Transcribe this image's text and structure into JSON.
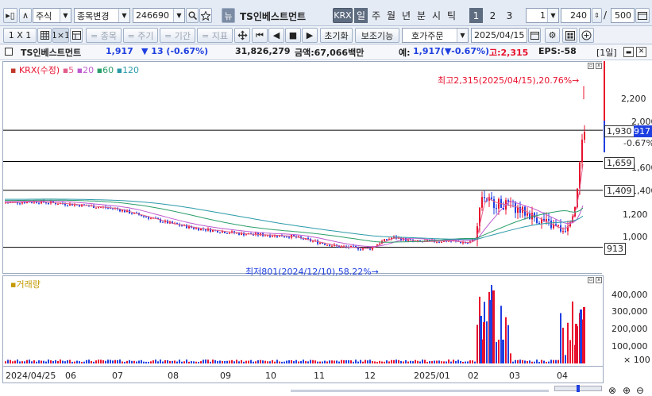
{
  "toolbar_top": {
    "back_glyph": "▸▯",
    "up_glyph": "∧",
    "market": "주식",
    "change_label": "종목변경",
    "code": "246690",
    "news_label": "뉴",
    "name": "TS인베스트먼트",
    "krx_label": "KRX",
    "periods": [
      "일",
      "주",
      "월",
      "년",
      "분",
      "시",
      "틱"
    ],
    "nums": [
      "1",
      "2",
      "3"
    ],
    "interval": "1",
    "count": "240",
    "total": "500"
  },
  "toolbar_second": {
    "view1": "1 X 1",
    "view2": "1×1",
    "item_label": "= 종목",
    "period_label": "= 주기",
    "range_label": "= 기간",
    "indicator_label": "= 지표",
    "reset_label": "초기화",
    "tools_label": "보조기능",
    "order_label": "호가주문",
    "date": "2025/04/15"
  },
  "infobar": {
    "name": "TS인베스트먼트",
    "price": "1,917",
    "change": "▼ 13 (-0.67%)",
    "volume": "31,826,279",
    "amount_label": "금액:67,066백만",
    "expected_label": "예:",
    "expected": "1,917(▼-0.67%)",
    "high_label": "고:2,315",
    "eps": "EPS:-58",
    "period_tag": "[1일]"
  },
  "price_pane": {
    "legend": "KRX(수정)",
    "ma": [
      "5",
      "20",
      "60",
      "120"
    ],
    "high_annotation": "최고2,315(2025/04/15),20.76%→",
    "low_annotation": "최저801(2024/12/10),58.22%→",
    "y_ticks": [
      "2,200",
      "2,000",
      "1,800",
      "1,600",
      "1,400",
      "1,200",
      "1,000"
    ],
    "current_label": "1,930",
    "current_suffix": "917",
    "change_pct": "-0.67%",
    "levels": [
      "1,659",
      "1,409",
      "913"
    ]
  },
  "volume_pane": {
    "legend": "거래량",
    "y_ticks": [
      "400,000",
      "300,000",
      "200,000",
      "100,000",
      "× 100"
    ]
  },
  "x_axis": [
    "2024/04/25",
    "06",
    "07",
    "08",
    "09",
    "10",
    "11",
    "12",
    "2025/01",
    "02",
    "03",
    "04"
  ],
  "colors": {
    "up": "#e8112d",
    "down": "#1f3fe0",
    "ma5": "#e35d8a",
    "ma20": "#c05ad0",
    "ma60": "#2a9e6a",
    "ma120": "#2a9aa8"
  }
}
